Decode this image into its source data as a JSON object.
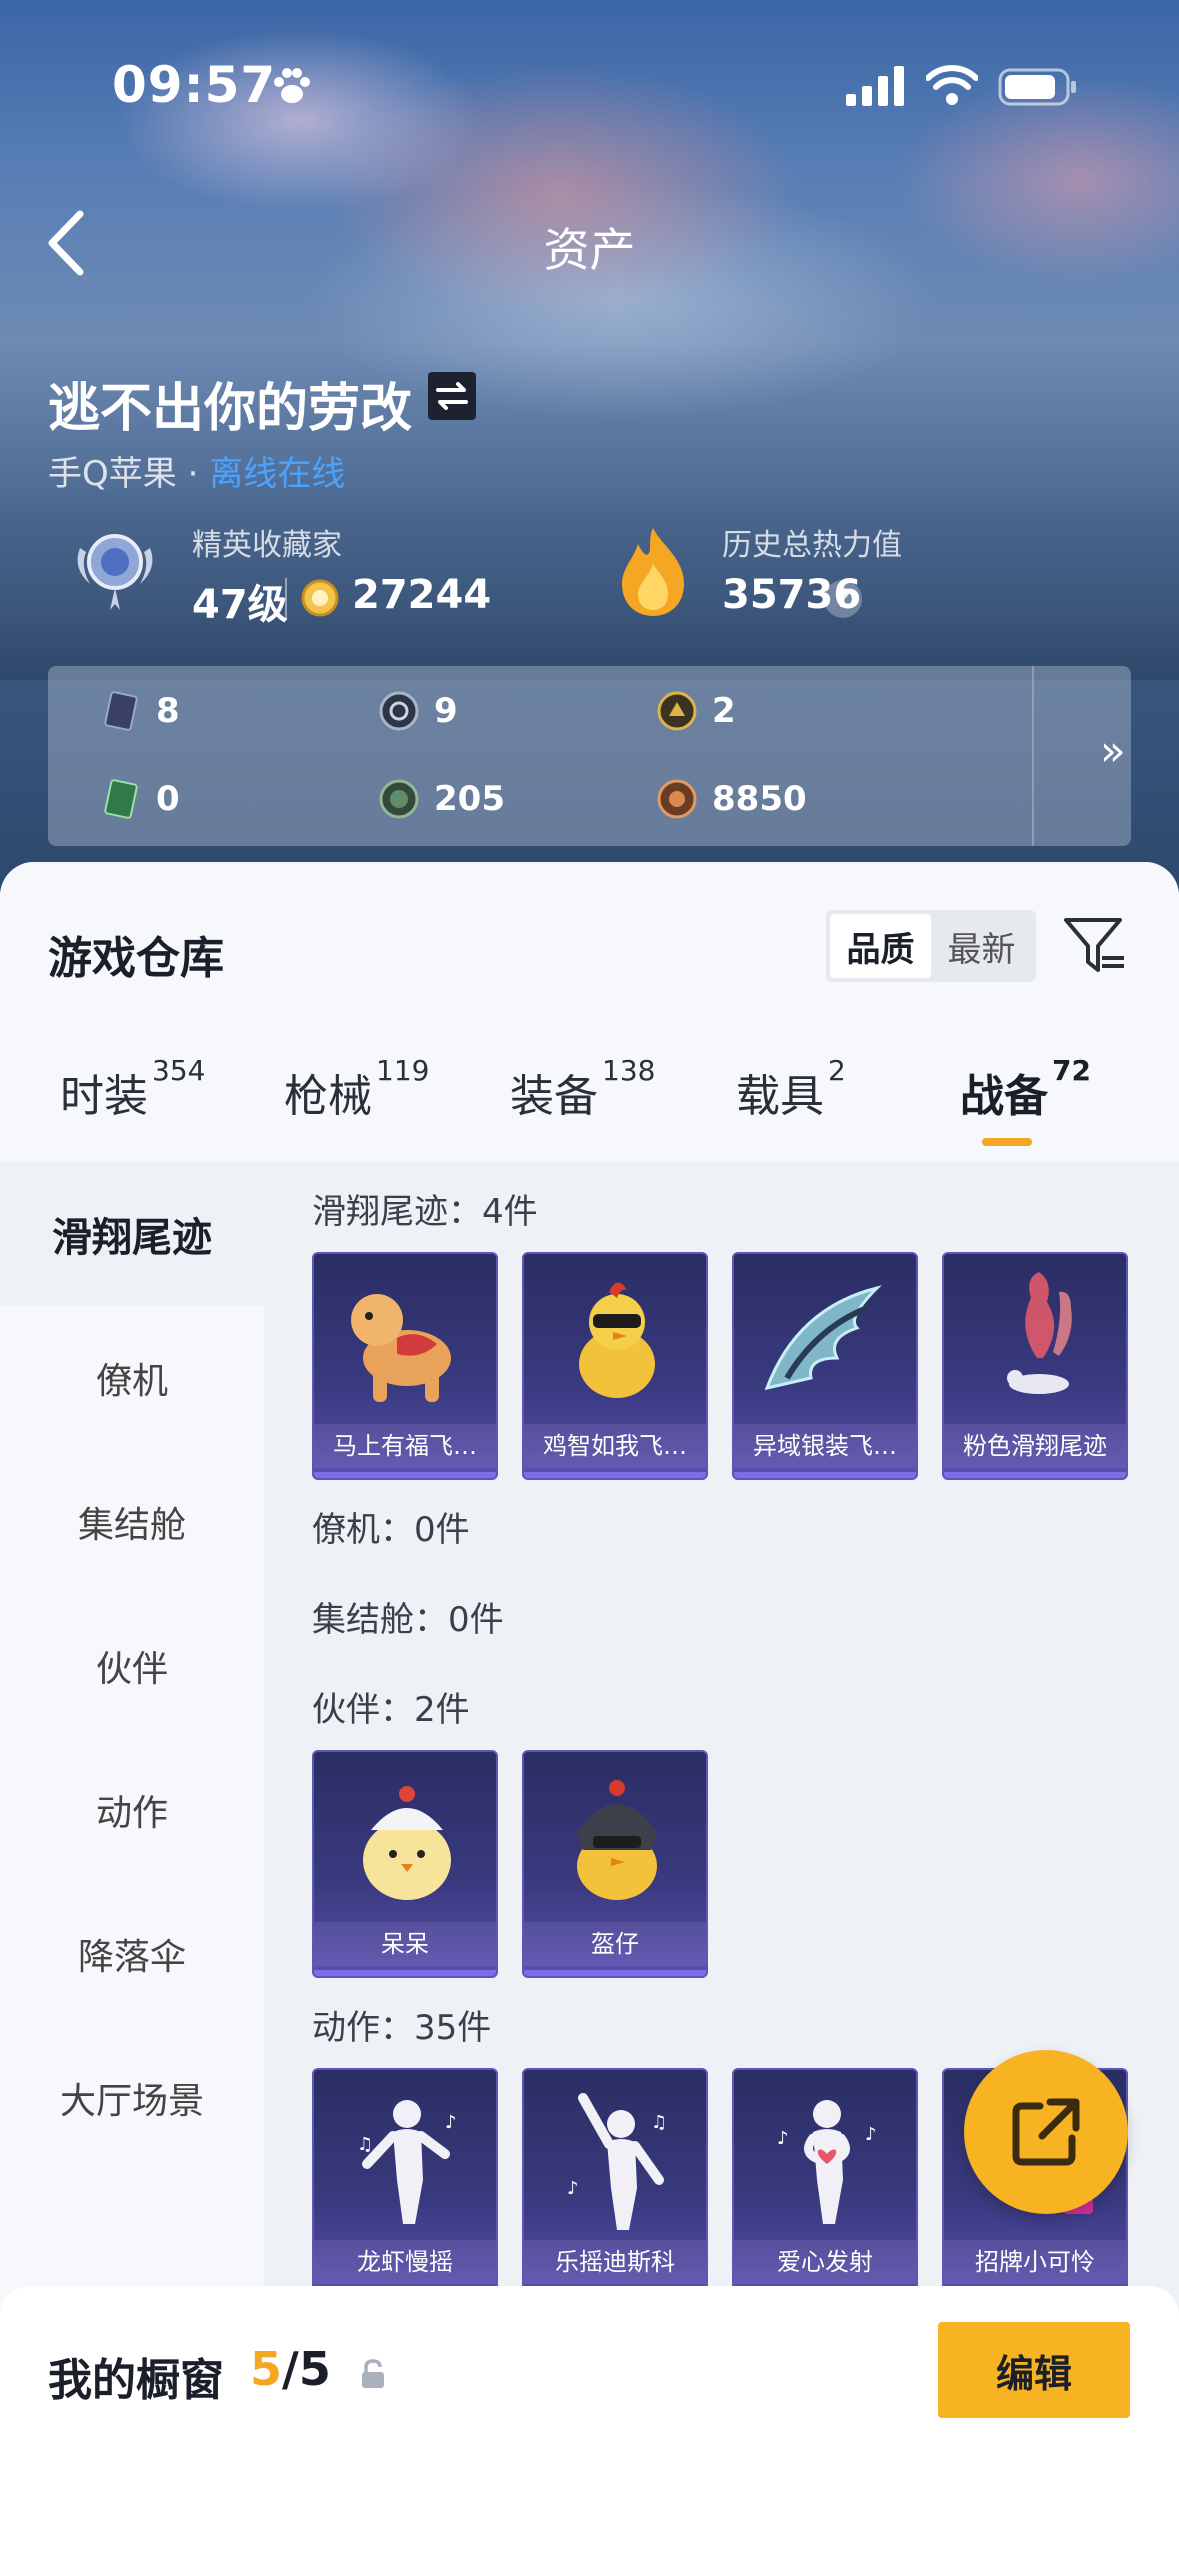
{
  "status_bar": {
    "time": "09:57"
  },
  "nav": {
    "title": "资产"
  },
  "profile": {
    "username": "逃不出你的劳改",
    "platform": "手Q苹果 ·",
    "status": "离线在线"
  },
  "stats": {
    "collector_label": "精英收藏家",
    "level": "47级",
    "points": "27244",
    "heat_label": "历史总热力值",
    "heat_value": "35736",
    "help_symbol": "?"
  },
  "currencies": [
    {
      "icon": "card-icon",
      "value": "8"
    },
    {
      "icon": "silver-coin-icon",
      "value": "9"
    },
    {
      "icon": "gold-coin-icon",
      "value": "2"
    },
    {
      "icon": "green-ticket-icon",
      "value": "0"
    },
    {
      "icon": "green-coin-icon",
      "value": "205"
    },
    {
      "icon": "bronze-coin-icon",
      "value": "8850"
    }
  ],
  "currency_more": "»",
  "warehouse": {
    "title": "游戏仓库",
    "sort_options": [
      "品质",
      "最新"
    ],
    "sort_selected": "品质"
  },
  "tabs": [
    {
      "label": "时装",
      "count": "354"
    },
    {
      "label": "枪械",
      "count": "119"
    },
    {
      "label": "装备",
      "count": "138"
    },
    {
      "label": "载具",
      "count": "2"
    },
    {
      "label": "战备",
      "count": "72"
    }
  ],
  "active_tab": "战备",
  "categories": [
    "滑翔尾迹",
    "僚机",
    "集结舱",
    "伙伴",
    "动作",
    "降落伞",
    "大厅场景"
  ],
  "active_category": "滑翔尾迹",
  "sections": [
    {
      "title": "滑翔尾迹：4件",
      "items": [
        "马上有福飞…",
        "鸡智如我飞…",
        "异域银装飞…",
        "粉色滑翔尾迹"
      ]
    },
    {
      "title": "僚机：0件",
      "items": []
    },
    {
      "title": "集结舱：0件",
      "items": []
    },
    {
      "title": "伙伴：2件",
      "items": [
        "呆呆",
        "盔仔"
      ]
    },
    {
      "title": "动作：35件",
      "items": [
        "龙虾慢摇",
        "乐摇迪斯科",
        "爱心发射",
        "招牌小可怜"
      ]
    }
  ],
  "showcase": {
    "label": "我的橱窗",
    "current": "5",
    "total": "/5"
  },
  "edit_button": "编辑",
  "colors": {
    "accent": "#f5a623",
    "card_bg": "#3a3a80",
    "online": "#4aa3ff"
  }
}
